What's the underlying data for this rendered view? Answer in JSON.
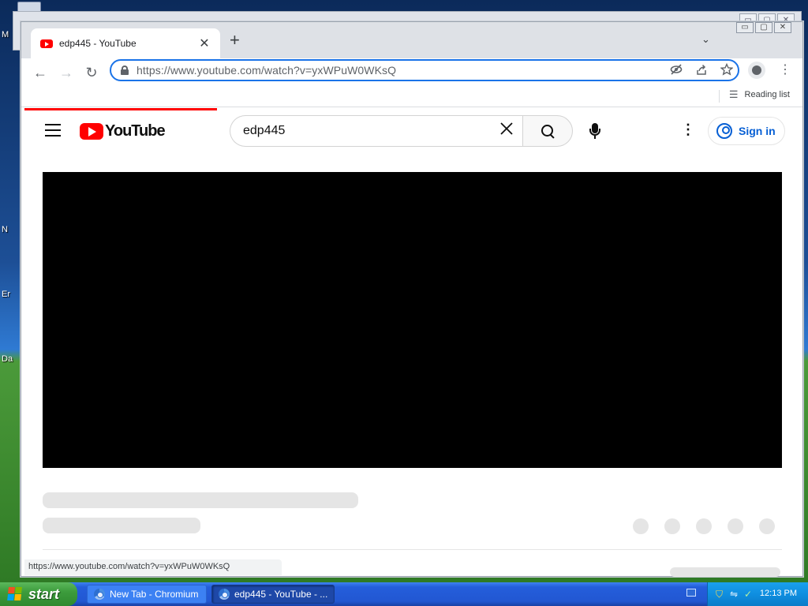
{
  "desktop": {
    "icon_labels": [
      "M",
      "N",
      "Er",
      "Da"
    ]
  },
  "browser": {
    "tab": {
      "title": "edp445 - YouTube",
      "close_glyph": "✕"
    },
    "new_tab_glyph": "+",
    "tab_search_glyph": "⌄",
    "window_controls": {
      "minimize": "▭",
      "maximize": "▢",
      "close": "✕"
    },
    "nav": {
      "back": "←",
      "forward": "→",
      "reload": "↻"
    },
    "omnibox": {
      "url": "https://www.youtube.com/watch?v=yxWPuW0WKsQ",
      "icons": [
        "eye-off-icon",
        "share-icon",
        "star-icon"
      ]
    },
    "reading_list": "Reading list",
    "status_url": "https://www.youtube.com/watch?v=yxWPuW0WKsQ"
  },
  "youtube": {
    "logo_text": "YouTube",
    "search_value": "edp445",
    "sign_in": "Sign in"
  },
  "taskbar": {
    "start_label": "start",
    "tasks": [
      {
        "label": "New Tab - Chromium",
        "active": false
      },
      {
        "label": "edp445 - YouTube - ...",
        "active": true
      }
    ],
    "clock": "12:13 PM"
  },
  "colors": {
    "youtube_red": "#ff0000",
    "focus_blue": "#1a73e8",
    "signin_blue": "#065fd4",
    "taskbar_blue": "#245edb",
    "start_green": "#3c9c3c"
  }
}
